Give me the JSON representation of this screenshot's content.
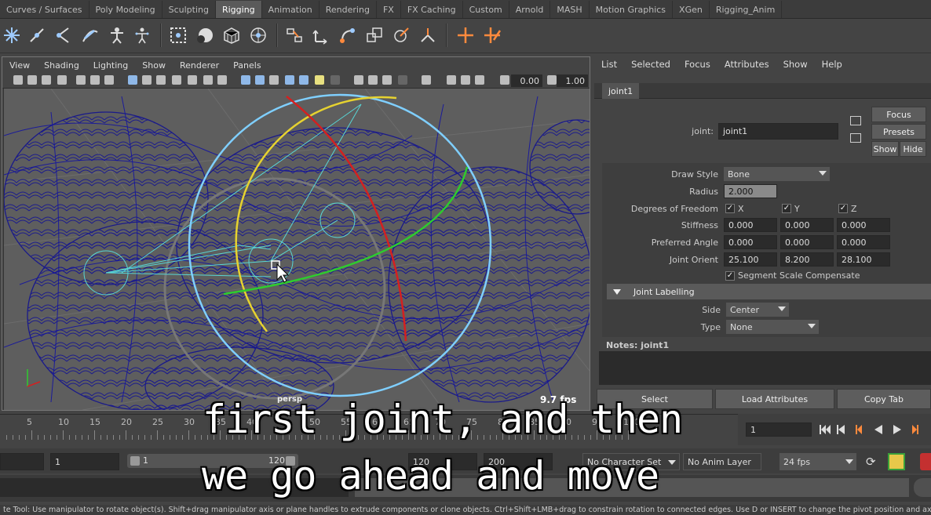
{
  "shelf_tabs": [
    "Curves / Surfaces",
    "Poly Modeling",
    "Sculpting",
    "Rigging",
    "Animation",
    "Rendering",
    "FX",
    "FX Caching",
    "Custom",
    "Arnold",
    "MASH",
    "Motion Graphics",
    "XGen",
    "Rigging_Anim"
  ],
  "shelf_active": "Rigging",
  "viewport": {
    "menu": [
      "View",
      "Shading",
      "Lighting",
      "Show",
      "Renderer",
      "Panels"
    ],
    "near_value": "0.00",
    "far_value": "1.00",
    "camera_label": "persp",
    "fps_label": "9.7 fps"
  },
  "attr_editor": {
    "menu": [
      "List",
      "Selected",
      "Focus",
      "Attributes",
      "Show",
      "Help"
    ],
    "tab": "joint1",
    "joint_label": "joint:",
    "joint_name": "joint1",
    "focus_btn": "Focus",
    "presets_btn": "Presets",
    "show_btn": "Show",
    "hide_btn": "Hide",
    "draw_style_label": "Draw Style",
    "draw_style_value": "Bone",
    "radius_label": "Radius",
    "radius_value": "2.000",
    "dof_label": "Degrees of Freedom",
    "dof_x": "X",
    "dof_y": "Y",
    "dof_z": "Z",
    "stiffness_label": "Stiffness",
    "stiffness": [
      "0.000",
      "0.000",
      "0.000"
    ],
    "pref_angle_label": "Preferred Angle",
    "pref_angle": [
      "0.000",
      "0.000",
      "0.000"
    ],
    "orient_label": "Joint Orient",
    "orient": [
      "25.100",
      "8.200",
      "28.100"
    ],
    "ssc_label": "Segment Scale Compensate",
    "labelling_section": "Joint Labelling",
    "side_label": "Side",
    "side_value": "Center",
    "type_label": "Type",
    "type_value": "None",
    "notes_label": "Notes:  joint1",
    "select_btn": "Select",
    "load_btn": "Load Attributes",
    "copy_btn": "Copy Tab"
  },
  "timeline": {
    "ticks": [
      "5",
      "10",
      "15",
      "20",
      "25",
      "30",
      "35",
      "40",
      "45",
      "50",
      "55",
      "60",
      "65",
      "70",
      "75",
      "80",
      "85",
      "90",
      "95",
      "100"
    ],
    "current_frame": "1"
  },
  "range": {
    "start": "1",
    "slider_start": "1",
    "slider_end": "120",
    "end": "120",
    "max_end": "200",
    "character_set": "No Character Set",
    "anim_layer": "No Anim Layer",
    "fps": "24 fps"
  },
  "help_text": "te Tool: Use manipulator to rotate object(s). Shift+drag manipulator axis or plane handles to extrude components or clone objects. Ctrl+Shift+LMB+drag to constrain rotation to connected edges. Use D or INSERT to change the pivot position and axis orientation.",
  "subtitles": {
    "line1": "first joint, and then",
    "line2": "we go ahead and move"
  },
  "colors": {
    "rotate_x": "#d42020",
    "rotate_y": "#2ecc2e",
    "rotate_z": "#e6d230",
    "rotate_view": "#7fcfff",
    "wireframe": "#1a1a8a",
    "joint": "#58d6d6"
  }
}
